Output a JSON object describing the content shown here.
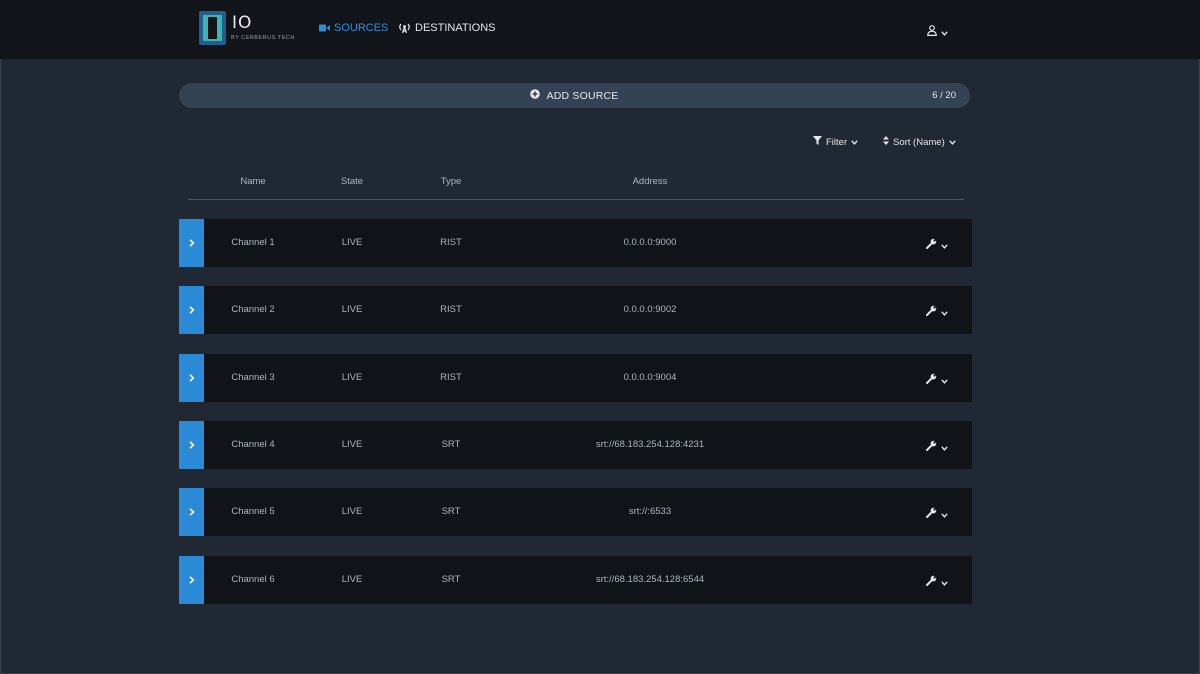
{
  "header": {
    "logo_text": "IO",
    "logo_subtext": "BY CERBERUS.TECH",
    "nav": [
      {
        "label": "SOURCES",
        "active": true
      },
      {
        "label": "DESTINATIONS",
        "active": false
      }
    ],
    "user_icon": "user-icon"
  },
  "toolbar": {
    "add_source_label": "ADD SOURCE",
    "count": "6 / 20",
    "filter_label": "Filter",
    "sort_label": "Sort (Name)"
  },
  "table": {
    "columns": [
      "Name",
      "State",
      "Type",
      "Address"
    ],
    "rows": [
      {
        "name": "Channel 1",
        "state": "LIVE",
        "type": "RIST",
        "address": "0.0.0.0:9000"
      },
      {
        "name": "Channel 2",
        "state": "LIVE",
        "type": "RIST",
        "address": "0.0.0.0:9002"
      },
      {
        "name": "Channel 3",
        "state": "LIVE",
        "type": "RIST",
        "address": "0.0.0.0:9004"
      },
      {
        "name": "Channel 4",
        "state": "LIVE",
        "type": "SRT",
        "address": "srt://68.183.254.128:4231"
      },
      {
        "name": "Channel 5",
        "state": "LIVE",
        "type": "SRT",
        "address": "srt://:6533"
      },
      {
        "name": "Channel 6",
        "state": "LIVE",
        "type": "SRT",
        "address": "srt://68.183.254.128:6544"
      }
    ]
  },
  "colors": {
    "accent": "#2b8ad6",
    "background": "#1f2833",
    "header_bg": "#111418",
    "row_bg": "#101418"
  }
}
